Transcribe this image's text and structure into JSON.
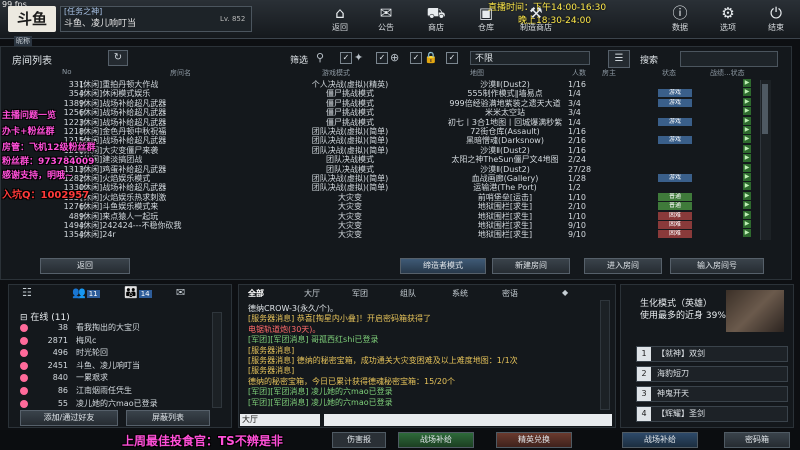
{
  "fps": "99 fps",
  "logo": "斗鱼",
  "profile": {
    "top": "[任务之神]",
    "name": "斗鱼、凌儿响叮当",
    "level": "Lv. 852",
    "sub_label": "昵称",
    "id_num": "999445"
  },
  "nav": [
    {
      "label": "返回",
      "icon": "home-icon",
      "glyph": "⌂"
    },
    {
      "label": "公告",
      "icon": "megaphone-icon",
      "glyph": "📢"
    },
    {
      "label": "商店",
      "icon": "shop-icon",
      "glyph": "🛒"
    },
    {
      "label": "仓库",
      "icon": "warehouse-icon",
      "glyph": "▣"
    },
    {
      "label": "制造商店",
      "icon": "craft-icon",
      "glyph": "⚒"
    },
    {
      "label": "数据",
      "icon": "data-icon",
      "glyph": "ⓘ"
    },
    {
      "label": "选项",
      "icon": "gear-icon",
      "glyph": "⚙"
    },
    {
      "label": "结束",
      "icon": "power-icon",
      "glyph": "⏻"
    }
  ],
  "stream_time": {
    "line1": "直播时间：下午14:00-16:30",
    "line2": "晚上18:30-24:00"
  },
  "room_list": {
    "title": "房间列表",
    "filter_label": "筛选",
    "map_filter": "不限",
    "search_label": "搜索",
    "columns": [
      "No",
      "房间名",
      "游戏模式",
      "地图",
      "人数",
      "房主",
      "状态",
      "战绩...状态"
    ],
    "rows": [
      {
        "no": "331",
        "name": "[休闲]重拍丹顿大作战",
        "mode": "个人决战(虚拟)(精英)",
        "map": "沙漠Ⅱ(Dust2)",
        "count": "1/16",
        "status": ""
      },
      {
        "no": "354",
        "name": "[休闲]休闲模式娱乐",
        "mode": "僵尸挑战模式",
        "map": "555制作模式∥墙易点",
        "count": "1/4",
        "status": "游戏"
      },
      {
        "no": "1389",
        "name": "[休闲]战场补给超凡武器",
        "mode": "僵尸挑战模式",
        "map": "999倍经验满地紫装之遗天大道",
        "count": "3/4",
        "status": "游戏"
      },
      {
        "no": "1256",
        "name": "[休闲]战场补给超凡武器",
        "mode": "僵尸挑战模式",
        "map": "米米太空站",
        "count": "3/4",
        "status": ""
      },
      {
        "no": "1223",
        "name": "[休闲]战场补给超凡武器",
        "mode": "僵尸挑战模式",
        "map": "初七丨3合1地图丨回城爆满秒紫",
        "count": "1/4",
        "status": "游戏"
      },
      {
        "no": "1218",
        "name": "[休闲]金色丹顿中秋祝福",
        "mode": "团队决战(虚拟)(简单)",
        "map": "72街仓库(Assault)",
        "count": "1/16",
        "status": ""
      },
      {
        "no": "1215",
        "name": "[休闲]战场补给超凡武器",
        "mode": "团队决战(虚拟)(简单)",
        "map": "黑暗憎魂(Darksnow)",
        "count": "2/16",
        "status": "游戏"
      },
      {
        "no": "1218",
        "name": "[休闲]大灾变僵尸来袭",
        "mode": "团队决战(虚拟)(简单)",
        "map": "沙漠Ⅱ(Dust2)",
        "count": "1/16",
        "status": ""
      },
      {
        "no": "1380",
        "name": "[休闲]建淡搞团战",
        "mode": "团队决战模式",
        "map": "太阳之神TheSun僵尸文4地图",
        "count": "2/24",
        "status": ""
      },
      {
        "no": "1313",
        "name": "[休闲]鸡蛋补给超凡武器",
        "mode": "团队决战模式",
        "map": "沙漠Ⅱ(Dust2)",
        "count": "27/28",
        "status": ""
      },
      {
        "no": "1282",
        "name": "[休闲]火焰娱乐模式",
        "mode": "团队决战(虚拟)(简单)",
        "map": "血战画廊(Gallery)",
        "count": "1/28",
        "status": "游戏"
      },
      {
        "no": "1330",
        "name": "[休闲]战场补给超凡武器",
        "mode": "团队决战(虚拟)(简单)",
        "map": "运输港(The Port)",
        "count": "1/2",
        "status": ""
      },
      {
        "no": "1337",
        "name": "[休闲]火焰娱乐热求刺激",
        "mode": "大灾变",
        "map": "前哨堡垒[运击]",
        "count": "1/10",
        "status": "普通"
      },
      {
        "no": "1276",
        "name": "[休闲]斗鱼娱乐模式来",
        "mode": "大灾变",
        "map": "地狱围栏[求生]",
        "count": "2/10",
        "status": "普通"
      },
      {
        "no": "489",
        "name": "[休闲]来点猿人一起玩",
        "mode": "大灾变",
        "map": "地狱围栏[求生]",
        "count": "1/10",
        "status": "困难"
      },
      {
        "no": "1494",
        "name": "[休闲]242424---不稳你砍我",
        "mode": "大灾变",
        "map": "地狱围栏[求生]",
        "count": "9/10",
        "status": "困难"
      },
      {
        "no": "1354",
        "name": "[休闲]24r",
        "mode": "大灾变",
        "map": "地狱围栏[求生]",
        "count": "9/10",
        "status": "困难"
      }
    ],
    "buttons": {
      "back": "返回",
      "enter_mode": "缔造者模式",
      "new_room": "新建房间",
      "enter_room": "进入房间",
      "enter_by_no": "输入房间号"
    }
  },
  "friends": {
    "tabs": [
      "",
      "11",
      "14",
      ""
    ],
    "online_header": "在线 (11)",
    "list": [
      {
        "num": "38",
        "name": "看我掏出的大宝贝"
      },
      {
        "num": "2871",
        "name": "梅风c"
      },
      {
        "num": "496",
        "name": "时光轮回"
      },
      {
        "num": "2451",
        "name": "斗鱼、凌儿响叮当"
      },
      {
        "num": "840",
        "name": "一累艰求"
      },
      {
        "num": "86",
        "name": "江南烟雨任凭生"
      },
      {
        "num": "55",
        "name": "凌儿她的六mao已登录"
      }
    ],
    "add_button": "添加/通过好友",
    "block_button": "屏蔽列表"
  },
  "chat": {
    "tabs": [
      "全部",
      "大厅",
      "军团",
      "组队",
      "系统",
      "密语"
    ],
    "lines": [
      {
        "text": "德纳CROW-3(永久/个)。",
        "color": "#dfe4e8"
      },
      {
        "text": "[服务器消息] 恭喜[掏星内小叠]！开启密码箱获得了",
        "color": "#e6c35a"
      },
      {
        "text": "电锯轨道炮(30天)。",
        "color": "#ff6a6a"
      },
      {
        "text": "[军团][军团消息] 哥孤西红shi已登录",
        "color": "#7fd17a"
      },
      {
        "text": "[服务器消息]",
        "color": "#e6c35a"
      },
      {
        "text": "[服务器消息] 德纳的秘密宝箱，成功通关大灾变困难及以上难度地图：1/1次",
        "color": "#e6c35a"
      },
      {
        "text": "[服务器消息]",
        "color": "#e6c35a"
      },
      {
        "text": "德纳的秘密宝箱，今日已累计获得德魂秘密宝箱：15/20个",
        "color": "#e6c35a"
      },
      {
        "text": "[军团][军团消息] 凌儿她的六mao已登录",
        "color": "#7fd17a"
      },
      {
        "text": "[军团][军团消息] 凌儿她的六mao已登录",
        "color": "#7fd17a"
      }
    ],
    "channel": "大厅"
  },
  "mode_panel": {
    "line1": "生化模式（英雄）",
    "line2": "使用最多的近身 39%",
    "slots": [
      {
        "key": "1",
        "label": "【就神】双剑"
      },
      {
        "key": "2",
        "label": "海豹短刀"
      },
      {
        "key": "3",
        "label": "神鬼开天"
      },
      {
        "key": "4",
        "label": "【辉耀】圣剑"
      }
    ]
  },
  "bottom_bar": {
    "items": [
      "伤害报",
      "战场补给",
      "精英兑换",
      "战场补给",
      "密码箱"
    ]
  },
  "overlay": {
    "host": "主播问题一览",
    "customer": "办卡+粉丝群",
    "fanclub": "房管：飞机12级粉丝群",
    "fan_group": "粉丝群：973784009",
    "thanks": "感谢支持，明哦~",
    "join": "入坑Q：1002957",
    "bottom": "上周最佳投食官：TS不辨是非"
  },
  "colors": {
    "accent_yellow": "#ffe94a",
    "overlay_pink": "#ff4fd8",
    "overlay_red": "#ff3a3a"
  }
}
